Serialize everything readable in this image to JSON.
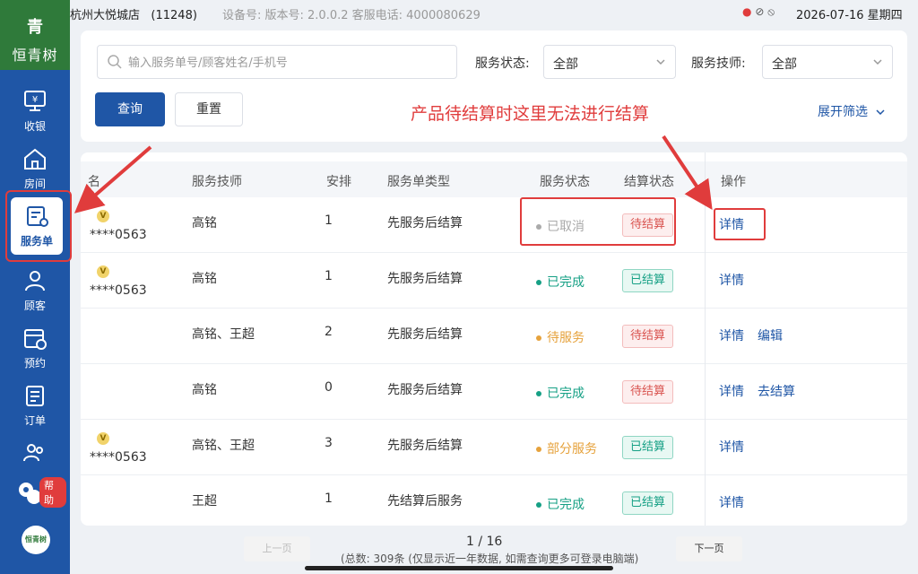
{
  "sidebar": {
    "brand_mark": "青",
    "brand_name": "恒青树",
    "items": [
      {
        "label": "收银",
        "icon": "cashier-icon"
      },
      {
        "label": "房间",
        "icon": "home-icon"
      },
      {
        "label": "服务单",
        "icon": "service-order-icon",
        "active": true
      },
      {
        "label": "顾客",
        "icon": "customer-icon"
      },
      {
        "label": "预约",
        "icon": "calendar-icon"
      },
      {
        "label": "订单",
        "icon": "order-icon"
      },
      {
        "label": "",
        "icon": "staff-icon"
      }
    ],
    "help_badge": "帮助",
    "bottom_logo": "恒青树"
  },
  "statusbar": {
    "store_name": "杭州大悦城店",
    "store_id": "(11248)",
    "device_info": "设备号:  版本号: 2.0.0.2  客服电话: 4000080629",
    "datetime": "2026-07-16 星期四"
  },
  "filter": {
    "search_placeholder": "输入服务单号/顾客姓名/手机号",
    "status_label": "服务状态:",
    "status_value": "全部",
    "tech_label": "服务技师:",
    "tech_value": "全部",
    "query_button": "查询",
    "reset_button": "重置",
    "expand_label": "展开筛选"
  },
  "annotation": "产品待结算时这里无法进行结算",
  "table": {
    "headers": {
      "col0": "名",
      "tech": "服务技师",
      "arrange": "安排",
      "type": "服务单类型",
      "status": "服务状态",
      "settle": "结算状态",
      "ops": "操作"
    },
    "rows": [
      {
        "vip": "V",
        "phone": "****0563",
        "tech": "高铭",
        "arrange": "1",
        "type": "先服务后结算",
        "status": "已取消",
        "status_color": "#aaaaaa",
        "settle": "待结算",
        "settle_kind": "pending",
        "ops": [
          "详情"
        ]
      },
      {
        "vip": "V",
        "phone": "****0563",
        "tech": "高铭",
        "arrange": "1",
        "type": "先服务后结算",
        "status": "已完成",
        "status_color": "#16a085",
        "settle": "已结算",
        "settle_kind": "done",
        "ops": [
          "详情"
        ]
      },
      {
        "vip": "",
        "phone": "",
        "tech": "高铭、王超",
        "arrange": "2",
        "type": "先服务后结算",
        "status": "待服务",
        "status_color": "#e6a23c",
        "settle": "待结算",
        "settle_kind": "pending",
        "ops": [
          "详情",
          "编辑"
        ]
      },
      {
        "vip": "",
        "phone": "",
        "tech": "高铭",
        "arrange": "0",
        "type": "先服务后结算",
        "status": "已完成",
        "status_color": "#16a085",
        "settle": "待结算",
        "settle_kind": "pending",
        "ops": [
          "详情",
          "去结算"
        ]
      },
      {
        "vip": "V",
        "phone": "****0563",
        "tech": "高铭、王超",
        "arrange": "3",
        "type": "先服务后结算",
        "status": "部分服务",
        "status_color": "#e6a23c",
        "settle": "已结算",
        "settle_kind": "done",
        "ops": [
          "详情"
        ]
      },
      {
        "vip": "",
        "phone": "",
        "tech": "王超",
        "arrange": "1",
        "type": "先结算后服务",
        "status": "已完成",
        "status_color": "#16a085",
        "settle": "已结算",
        "settle_kind": "done",
        "ops": [
          "详情"
        ]
      }
    ]
  },
  "pagination": {
    "prev": "上一页",
    "next": "下一页",
    "page": "1 / 16",
    "total_text": "(总数: 309条 (仅显示近一年数据, 如需查询更多可登录电脑端)"
  }
}
